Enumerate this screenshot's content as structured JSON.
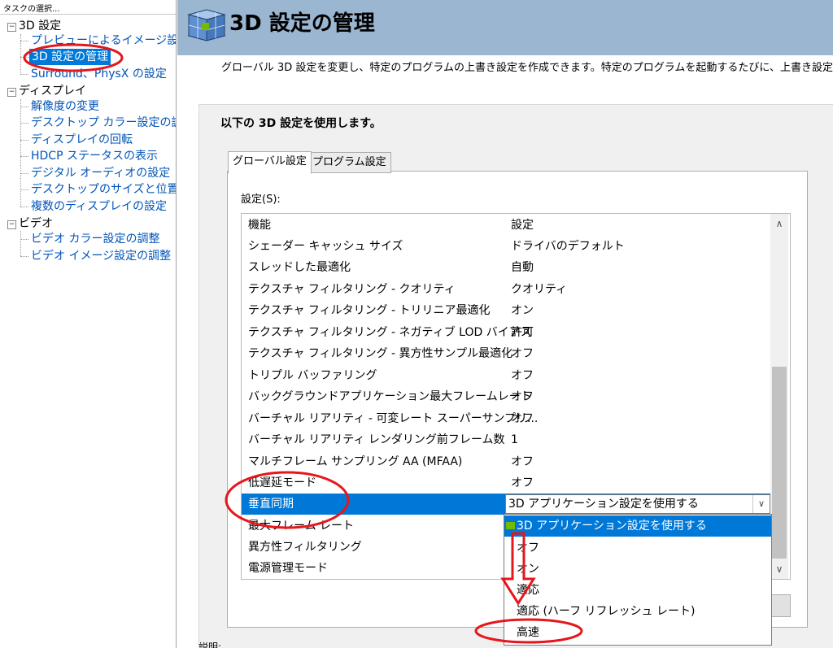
{
  "left_panel": {
    "header": "タスクの選択...",
    "categories": [
      {
        "label": "3D 設定",
        "items": [
          "プレビューによるイメージ設定の",
          "3D 設定の管理",
          "Surround、PhysX の設定"
        ]
      },
      {
        "label": "ディスプレイ",
        "items": [
          "解像度の変更",
          "デスクトップ カラー設定の調整",
          "ディスプレイの回転",
          "HDCP ステータスの表示",
          "デジタル オーディオの設定",
          "デスクトップのサイズと位置の調",
          "複数のディスプレイの設定"
        ]
      },
      {
        "label": "ビデオ",
        "items": [
          "ビデオ カラー設定の調整",
          "ビデオ イメージ設定の調整"
        ]
      }
    ],
    "selected_item": "3D 設定の管理"
  },
  "header": {
    "title": "3D 設定の管理",
    "icon": "nvidia-3d-cube-icon"
  },
  "description": "グローバル 3D 設定を変更し、特定のプログラムの上書き設定を作成できます。特定のプログラムを起動するたびに、上書き設定",
  "group_title": "以下の 3D 設定を使用します。",
  "tabs": [
    {
      "label": "グローバル設定",
      "active": true
    },
    {
      "label": "プログラム設定",
      "active": false
    }
  ],
  "settings_label": "設定(S):",
  "table": {
    "columns": [
      "機能",
      "設定"
    ],
    "rows": [
      {
        "feature": "シェーダー キャッシュ サイズ",
        "value": "ドライバのデフォルト"
      },
      {
        "feature": "スレッドした最適化",
        "value": "自動"
      },
      {
        "feature": "テクスチャ フィルタリング - クオリティ",
        "value": "クオリティ"
      },
      {
        "feature": "テクスチャ フィルタリング - トリリニア最適化",
        "value": "オン"
      },
      {
        "feature": "テクスチャ フィルタリング - ネガティブ LOD バイアス",
        "value": "許可"
      },
      {
        "feature": "テクスチャ フィルタリング - 異方性サンプル最適化",
        "value": "オフ"
      },
      {
        "feature": "トリプル バッファリング",
        "value": "オフ"
      },
      {
        "feature": "バックグラウンドアプリケーション最大フレームレート",
        "value": "オフ"
      },
      {
        "feature": "バーチャル リアリティ - 可変レート スーパーサンプリ...",
        "value": "オフ"
      },
      {
        "feature": "バーチャル リアリティ レンダリング前フレーム数",
        "value": "1"
      },
      {
        "feature": "マルチフレーム サンプリング AA (MFAA)",
        "value": "オフ"
      },
      {
        "feature": "低遅延モード",
        "value": "オフ"
      },
      {
        "feature": "垂直同期",
        "value": "3D アプリケーション設定を使用する",
        "selected": true
      },
      {
        "feature": "最大フレーム レート",
        "value": ""
      },
      {
        "feature": "異方性フィルタリング",
        "value": ""
      },
      {
        "feature": "電源管理モード",
        "value": ""
      }
    ]
  },
  "dropdown": {
    "options": [
      "3D アプリケーション設定を使用する",
      "オフ",
      "オン",
      "適応",
      "適応 (ハーフ リフレッシュ レート)",
      "高速"
    ],
    "highlighted": "3D アプリケーション設定を使用する"
  },
  "bottom_label": "説明:",
  "colors": {
    "header_bg": "#9bb6d1",
    "selection": "#0078d7",
    "annotation_red": "#e5161c",
    "nvidia_green": "#76b900"
  }
}
